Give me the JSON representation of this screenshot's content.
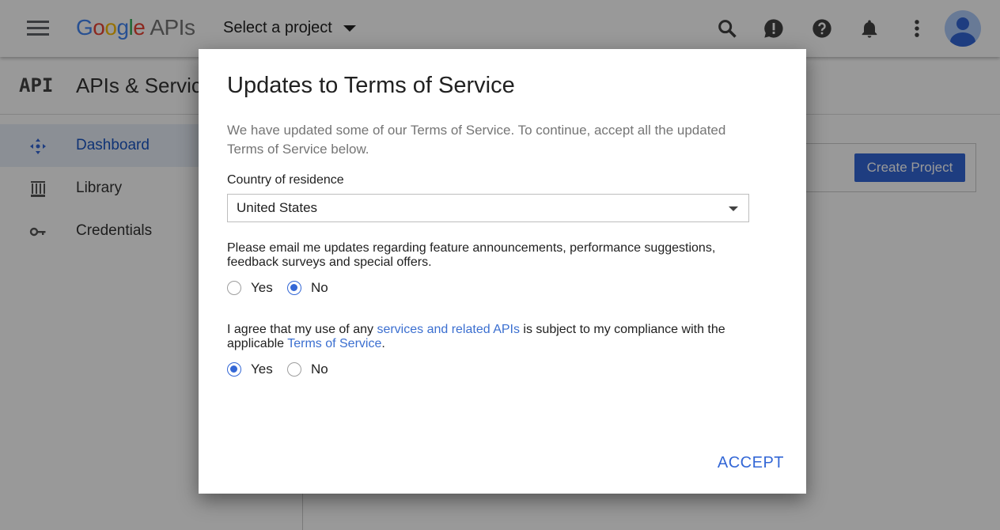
{
  "topbar": {
    "logo_parts": [
      "G",
      "o",
      "o",
      "g",
      "l",
      "e"
    ],
    "logo_suffix": "APIs",
    "project_select_label": "Select a project",
    "icons": [
      "search-icon",
      "feedback-icon",
      "help-icon",
      "notifications-icon",
      "more-vert-icon",
      "account-avatar"
    ]
  },
  "subheader": {
    "badge": "API",
    "title": "APIs & Services"
  },
  "sidebar": {
    "items": [
      {
        "label": "Dashboard",
        "icon": "dashboard-icon",
        "active": true
      },
      {
        "label": "Library",
        "icon": "library-icon",
        "active": false
      },
      {
        "label": "Credentials",
        "icon": "key-icon",
        "active": false
      }
    ]
  },
  "content": {
    "create_project_label": "Create Project"
  },
  "dialog": {
    "title": "Updates to Terms of Service",
    "description": "We have updated some of our Terms of Service. To continue, accept all the updated Terms of Service below.",
    "country_label": "Country of residence",
    "country_value": "United States",
    "email_question": "Please email me updates regarding feature announcements, performance suggestions, feedback surveys and special offers.",
    "email_options": [
      {
        "label": "Yes",
        "checked": false
      },
      {
        "label": "No",
        "checked": true
      }
    ],
    "agree_prefix": "I agree that my use of any ",
    "agree_link": "services and related APIs",
    "agree_middle": " is subject to my compliance with the applicable ",
    "agree_tos_link": "Terms of Service",
    "agree_suffix": ".",
    "agree_options": [
      {
        "label": "Yes",
        "checked": true
      },
      {
        "label": "No",
        "checked": false
      }
    ],
    "accept_label": "ACCEPT"
  },
  "colors": {
    "accent": "#3367d6",
    "link": "#3b6fd0",
    "scrim": "rgba(0,0,0,0.4)"
  }
}
